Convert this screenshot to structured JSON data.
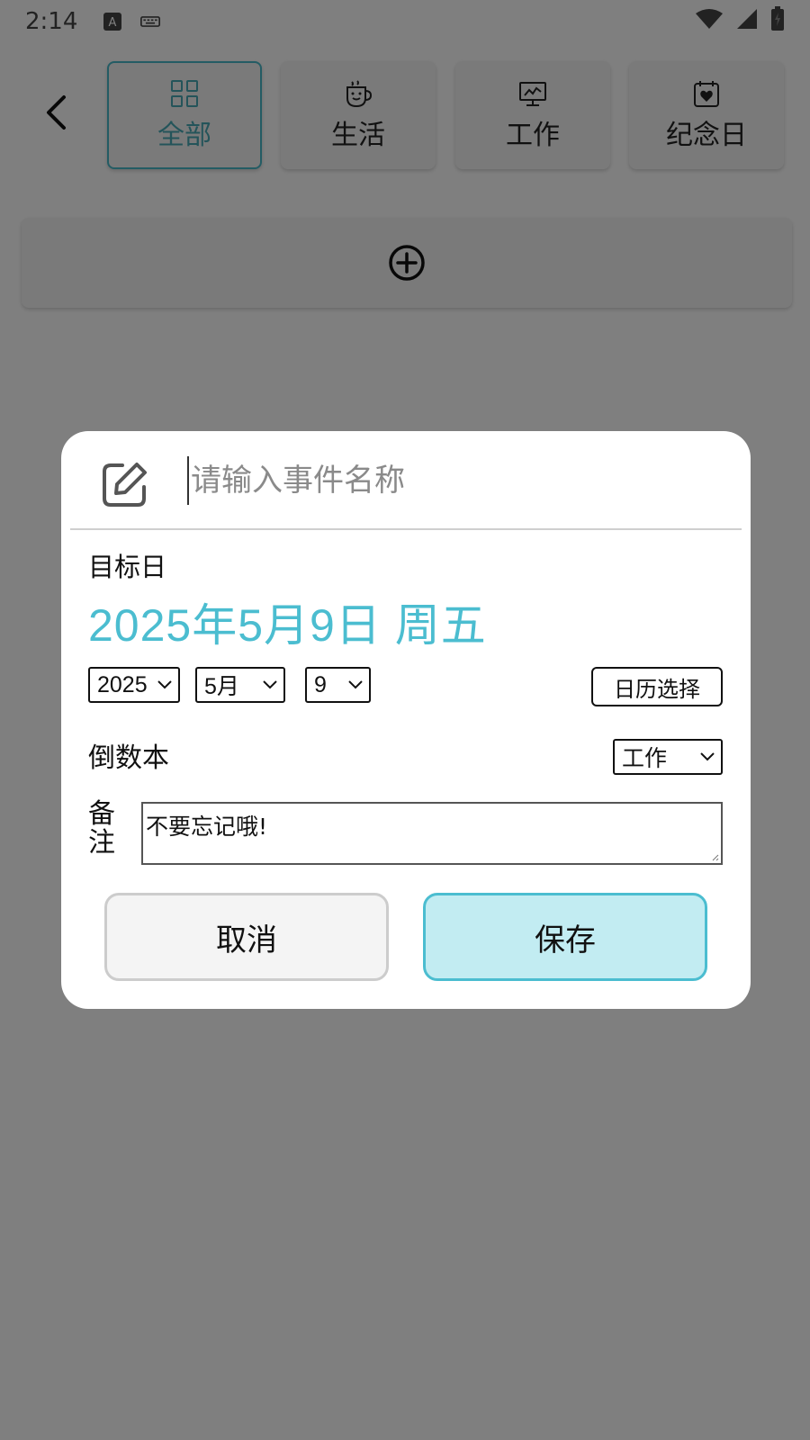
{
  "status_bar": {
    "time": "2:14"
  },
  "categories": [
    {
      "label": "全部",
      "icon": "grid-icon",
      "active": true
    },
    {
      "label": "生活",
      "icon": "coffee-cup-icon",
      "active": false
    },
    {
      "label": "工作",
      "icon": "monitor-chart-icon",
      "active": false
    },
    {
      "label": "纪念日",
      "icon": "calendar-heart-icon",
      "active": false
    }
  ],
  "dialog": {
    "name_placeholder": "请输入事件名称",
    "name_value": "",
    "target_label": "目标日",
    "target_date": "2025年5月9日 周五",
    "year_value": "2025",
    "month_value": "5月",
    "day_value": "9",
    "calendar_button": "日历选择",
    "book_label": "倒数本",
    "book_value": "工作",
    "note_label": "备注",
    "note_value": "不要忘记哦!",
    "cancel_button": "取消",
    "save_button": "保存"
  },
  "colors": {
    "accent": "#4bbdd0",
    "save_bg": "#c2ecf2",
    "cancel_bg": "#f4f4f4",
    "overlay": "rgba(0,0,0,0.5)"
  }
}
